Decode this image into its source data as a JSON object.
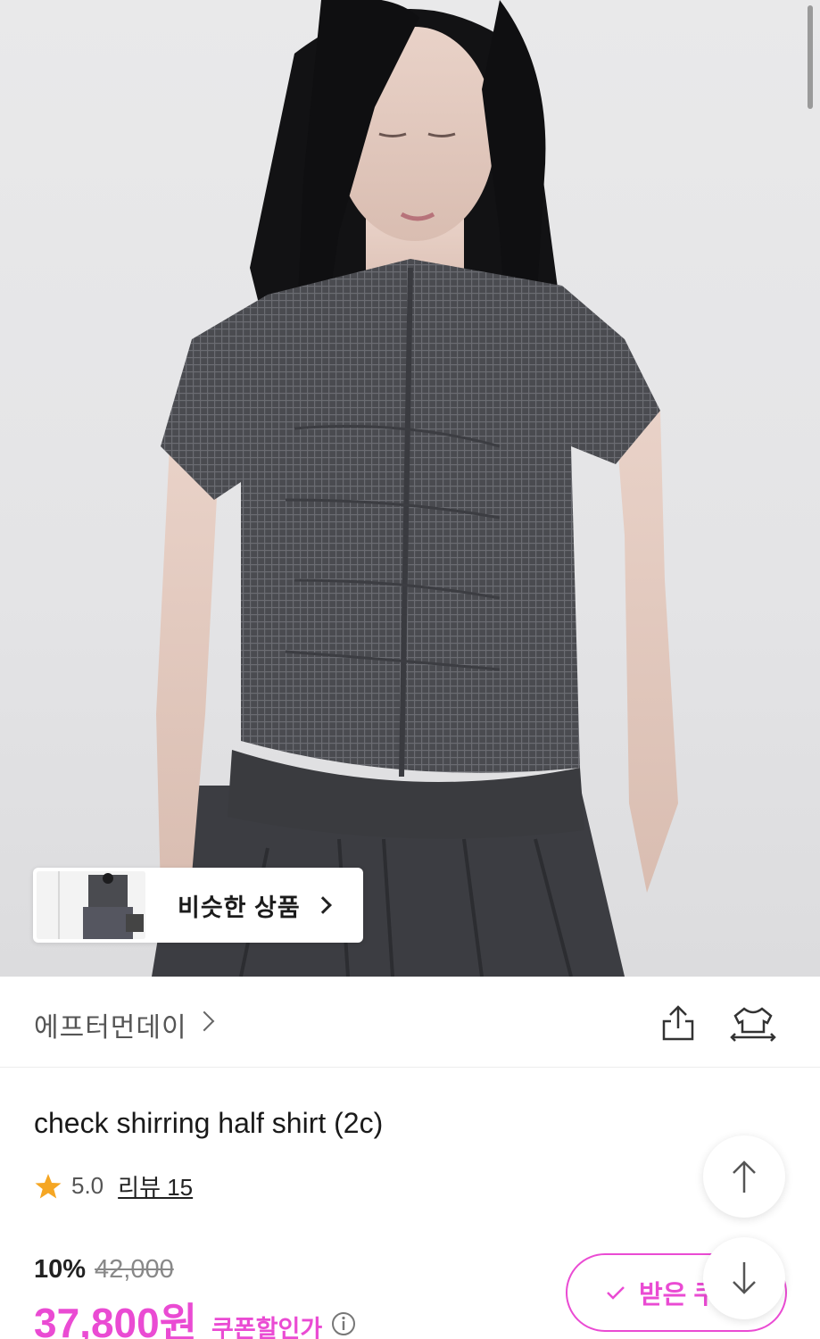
{
  "similar": {
    "label": "비슷한 상품"
  },
  "brand": {
    "name": "에프터먼데이"
  },
  "product": {
    "title": "check shirring half shirt (2c)",
    "rating": "5.0",
    "review_label": "리뷰 15",
    "discount_rate": "10%",
    "original_price": "42,000",
    "price": "37,800원",
    "coupon_label": "쿠폰할인가"
  },
  "coupon_button": {
    "label": "받은 쿠"
  },
  "colors": {
    "accent": "#ea4bd3",
    "star": "#f5a623"
  },
  "icons": [
    "share-icon",
    "try-on-icon",
    "star-icon",
    "info-icon",
    "check-icon",
    "arrow-up-icon",
    "arrow-down-icon",
    "chevron-right-icon"
  ]
}
